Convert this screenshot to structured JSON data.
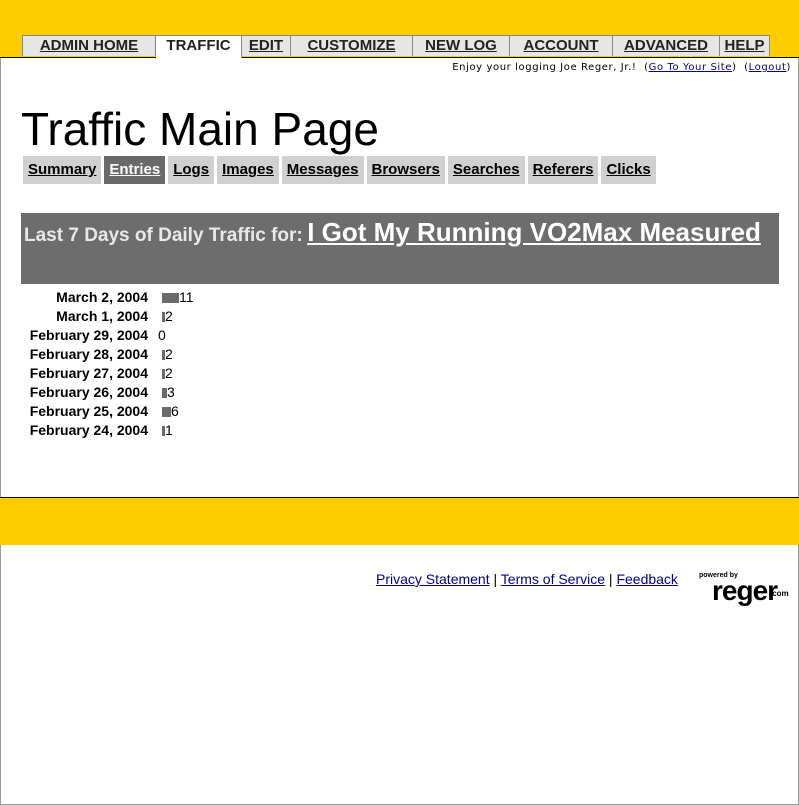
{
  "nav": {
    "tabs": [
      {
        "label": "ADMIN HOME"
      },
      {
        "label": "TRAFFIC"
      },
      {
        "label": "EDIT"
      },
      {
        "label": "CUSTOMIZE"
      },
      {
        "label": "NEW LOG"
      },
      {
        "label": "ACCOUNT"
      },
      {
        "label": "ADVANCED"
      },
      {
        "label": "HELP"
      }
    ],
    "active_tab": "TRAFFIC"
  },
  "welcome": {
    "text": "Enjoy your logging Joe Reger, Jr.!",
    "go_to_site": "Go To Your Site",
    "logout": "Logout"
  },
  "page_title": "Traffic Main Page",
  "subtabs": [
    {
      "label": "Summary"
    },
    {
      "label": "Entries"
    },
    {
      "label": "Logs"
    },
    {
      "label": "Images"
    },
    {
      "label": "Messages"
    },
    {
      "label": "Browsers"
    },
    {
      "label": "Searches"
    },
    {
      "label": "Referers"
    },
    {
      "label": "Clicks"
    }
  ],
  "active_subtab": "Entries",
  "traffic": {
    "lead": "Last 7 Days of Daily Traffic for:",
    "entry_title": "I Got My Running VO2Max Measured",
    "rows": [
      {
        "date": "March 2, 2004",
        "count": "11"
      },
      {
        "date": "March 1, 2004",
        "count": "2"
      },
      {
        "date": "February 29, 2004",
        "count": "0"
      },
      {
        "date": "February 28, 2004",
        "count": "2"
      },
      {
        "date": "February 27, 2004",
        "count": "2"
      },
      {
        "date": "February 26, 2004",
        "count": "3"
      },
      {
        "date": "February 25, 2004",
        "count": "6"
      },
      {
        "date": "February 24, 2004",
        "count": "1"
      }
    ],
    "bar_color": "#6a6a6a"
  },
  "footer": {
    "privacy": "Privacy Statement",
    "terms": "Terms of Service",
    "feedback": "Feedback",
    "sep": "|",
    "logo_small": "powered by",
    "logo_big": "reger",
    "logo_dot": ".com"
  },
  "colors": {
    "brand_yellow": "#ffcc00",
    "link_blue": "#00008b"
  }
}
